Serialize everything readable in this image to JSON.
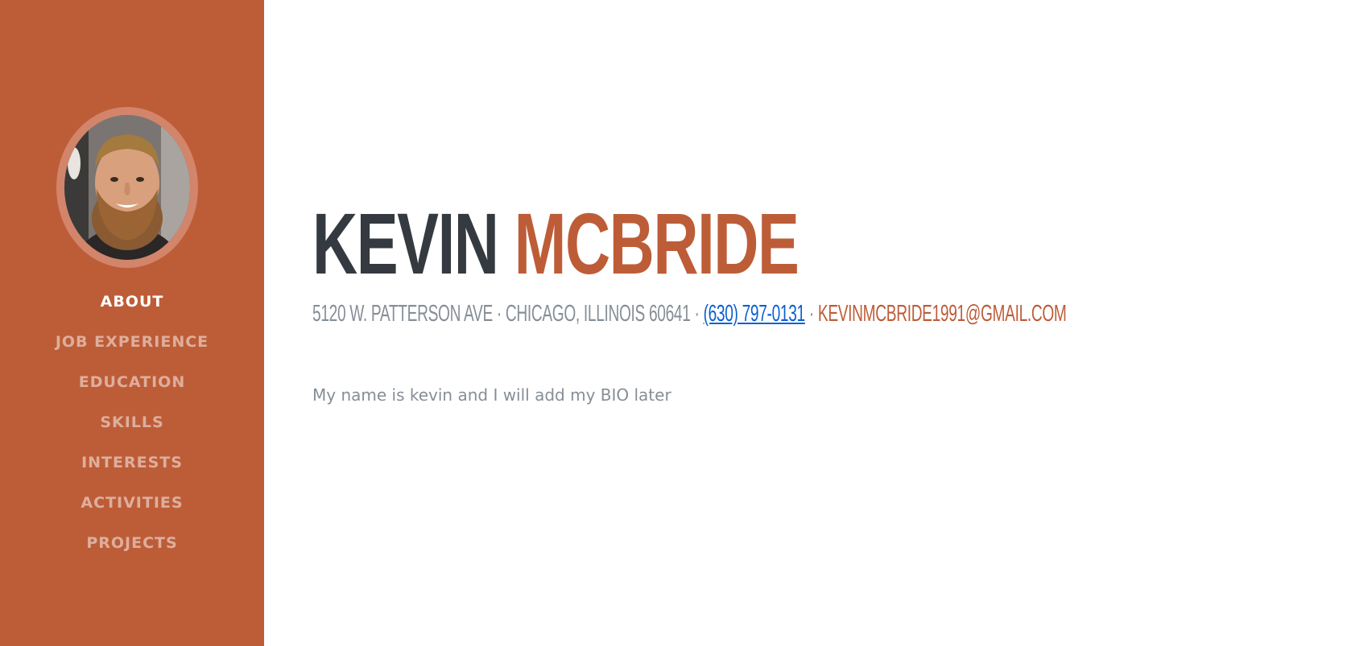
{
  "sidebar": {
    "background": "#bd5d38",
    "avatar_icon": "profile-photo",
    "nav": [
      {
        "label": "ABOUT",
        "active": true
      },
      {
        "label": "JOB EXPERIENCE",
        "active": false
      },
      {
        "label": "EDUCATION",
        "active": false
      },
      {
        "label": "SKILLS",
        "active": false
      },
      {
        "label": "INTERESTS",
        "active": false
      },
      {
        "label": "ACTIVITIES",
        "active": false
      },
      {
        "label": "PROJECTS",
        "active": false
      }
    ]
  },
  "header": {
    "first_name": "KEVIN",
    "last_name": "MCBRIDE"
  },
  "contact": {
    "address": "5120 W. PATTERSON AVE · CHICAGO, ILLINOIS 60641 ·",
    "phone": "(630) 797-0131",
    "separator": "·",
    "email": "KEVINMCBRIDE1991@GMAIL.COM"
  },
  "about": {
    "bio": "My name is kevin and I will add my BIO later"
  },
  "colors": {
    "accent": "#bd5d38",
    "heading": "#343a40",
    "muted": "#868e96",
    "link": "#0b5fd3"
  }
}
